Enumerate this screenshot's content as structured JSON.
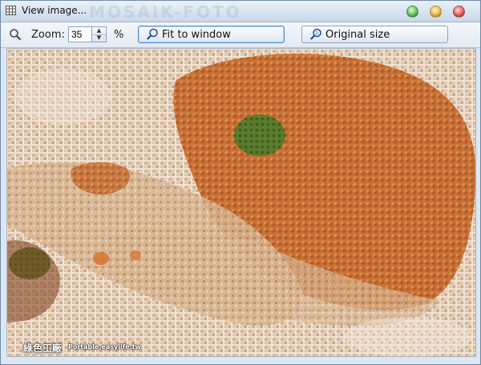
{
  "window": {
    "title": "View image...",
    "title_watermark": "MOSAIK-FOTO"
  },
  "toolbar": {
    "zoom_label": "Zoom:",
    "zoom_value": "35",
    "percent_label": "%",
    "fit_label": "Fit to window",
    "original_label": "Original size"
  },
  "image": {
    "watermark_cn": "綠色工廠",
    "watermark_en": "Portable.easylife.tw"
  },
  "colors": {
    "titlebar": "#c8d8ea",
    "accent_focus": "#4d8ad1",
    "mosaic_background": "#ead8c4",
    "food_orange": "#c8692b",
    "herb_green": "#4f7a2a"
  }
}
